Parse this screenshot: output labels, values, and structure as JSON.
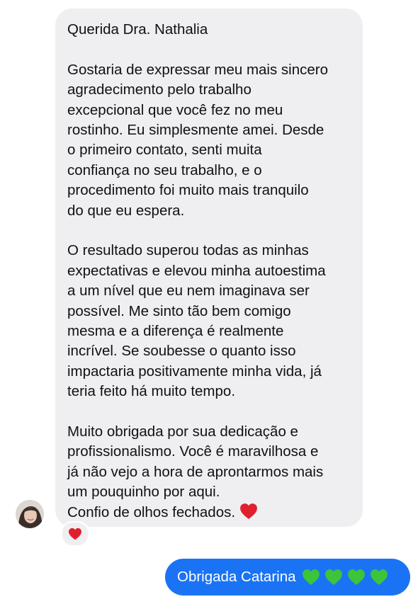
{
  "incoming_message": {
    "greeting": "Querida Dra. Nathalia",
    "paragraph_1": [
      "Gostaria de expressar meu mais sincero",
      "agradecimento pelo trabalho",
      "excepcional que você fez no meu",
      "rostinho. Eu simplesmente amei. Desde",
      "o primeiro contato, senti muita",
      "confiança no seu trabalho, e o",
      "procedimento foi muito mais tranquilo",
      "do que eu espera."
    ],
    "paragraph_2": [
      "O resultado superou todas as minhas",
      "expectativas e elevou minha autoestima",
      "a um nível que eu nem imaginava ser",
      "possível. Me sinto tão bem comigo",
      "mesma e a diferença é realmente",
      "incrível. Se soubesse o quanto isso",
      "impactaria positivamente minha vida, já",
      "teria feito há muito tempo."
    ],
    "paragraph_3": [
      "Muito obrigada por sua dedicação e",
      "profissionalismo. Você é maravilhosa e",
      "já não vejo a hora de aprontarmos mais",
      "um pouquinho por aqui.",
      "Confio de olhos fechados."
    ],
    "trailing_emoji": "red-heart-icon",
    "reaction_emoji": "red-heart-icon"
  },
  "outgoing_message": {
    "text": "Obrigada Catarina",
    "emojis": [
      "green-heart-icon",
      "green-heart-icon",
      "green-heart-icon",
      "green-heart-icon"
    ]
  },
  "colors": {
    "incoming_bubble": "#efeff1",
    "outgoing_bubble": "#1a73f4",
    "red_heart": "#e0202f",
    "green_heart": "#3cc43a"
  }
}
